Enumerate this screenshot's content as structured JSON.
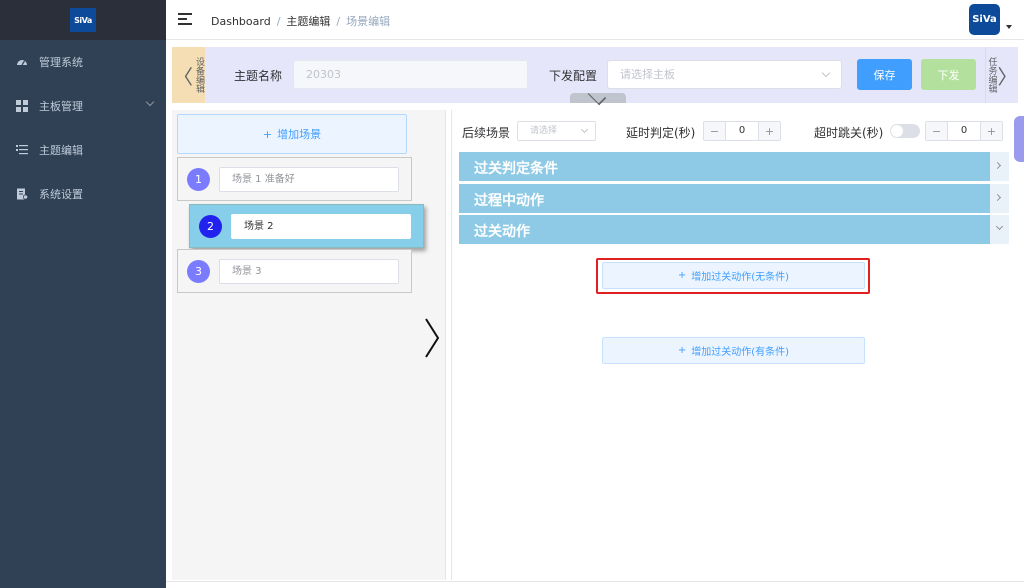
{
  "app": {
    "logo_text": "SiVa"
  },
  "sidebar": {
    "items": [
      {
        "label": "管理系统",
        "icon": "dashboard-icon"
      },
      {
        "label": "主板管理",
        "icon": "grid-icon",
        "has_submenu": true
      },
      {
        "label": "主题编辑",
        "icon": "list-icon"
      },
      {
        "label": "系统设置",
        "icon": "settings-doc-icon"
      }
    ]
  },
  "header": {
    "breadcrumb": [
      "Dashboard",
      "主题编辑",
      "场景编辑"
    ],
    "avatar_text": "SiVa"
  },
  "config": {
    "left_tab": "设备编辑",
    "right_tab": "任务编辑",
    "theme_name_label": "主题名称",
    "theme_name_value": "20303",
    "dispatch_label": "下发配置",
    "dispatch_placeholder": "请选择主板",
    "save_label": "保存",
    "issue_label": "下发"
  },
  "scenes": {
    "add_label": "增加场景",
    "items": [
      {
        "num": "1",
        "name": "场景 1 准备好",
        "active": false
      },
      {
        "num": "2",
        "name": "场景 2",
        "active": true
      },
      {
        "num": "3",
        "name": "场景 3",
        "active": false
      }
    ]
  },
  "editor": {
    "next_scene_label": "后续场景",
    "next_scene_placeholder": "请选择",
    "delay_label": "延时判定(秒)",
    "delay_value": "0",
    "timeout_label": "超时跳关(秒)",
    "timeout_value": "0",
    "timeout_enabled": false,
    "sections": [
      {
        "title": "过关判定条件",
        "expanded": false
      },
      {
        "title": "过程中动作",
        "expanded": false
      },
      {
        "title": "过关动作",
        "expanded": true
      }
    ],
    "add_action_unconditional": "增加过关动作(无条件)",
    "add_action_conditional": "增加过关动作(有条件)"
  },
  "colors": {
    "sidebar_bg": "#304156",
    "accent": "#409eff",
    "accordion": "#8ecae6",
    "active_scene": "#87ceeb",
    "highlight": "#e02020"
  }
}
